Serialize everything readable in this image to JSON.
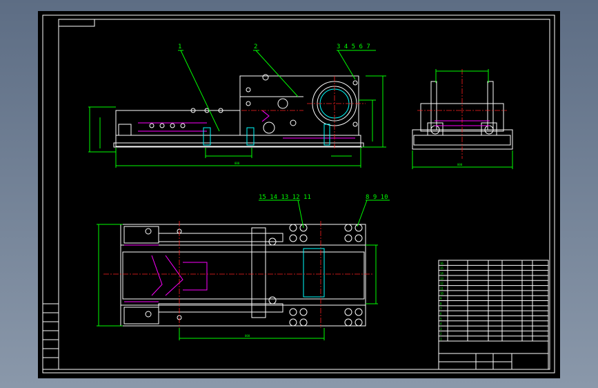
{
  "drawing": {
    "part_labels_front": [
      "1",
      "2",
      "3 4 5 6 7"
    ],
    "part_labels_top": [
      "15 14 13 12 11",
      "8 9 10"
    ],
    "front_dim_bottom": "000",
    "side_dim_bottom": "000",
    "top_dim_bottom": "000"
  },
  "bom_rows": [
    "16",
    "15",
    "14",
    "13",
    "12",
    "11",
    "10",
    "9",
    "8",
    "7",
    "6",
    "5",
    "4",
    "3",
    "2",
    "1"
  ],
  "colors": {
    "background": "#000000",
    "outline": "#ffffff",
    "dimension": "#00ff00",
    "part": "#00ffff",
    "hidden": "#ff00ff",
    "centerline": "#ff2020"
  }
}
